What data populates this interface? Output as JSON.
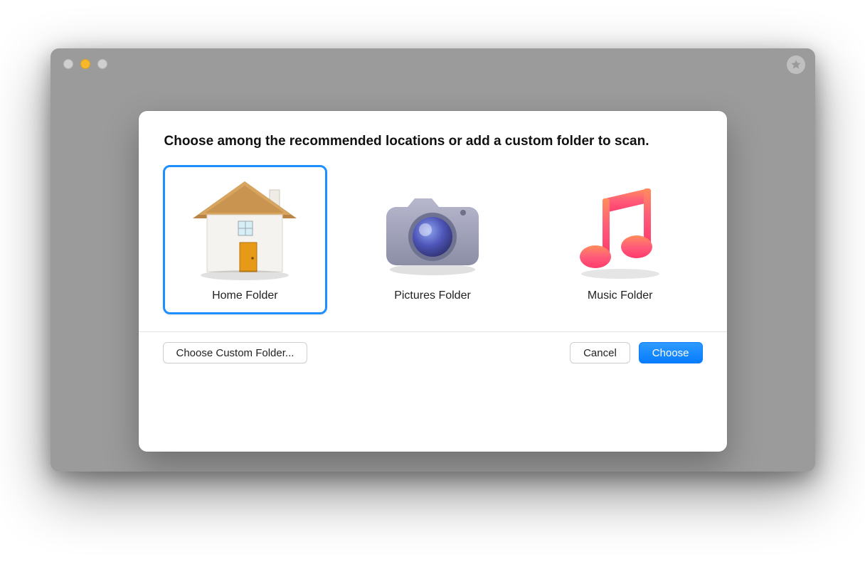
{
  "dialog": {
    "heading": "Choose among the recommended locations or add a custom folder to scan.",
    "options": [
      {
        "id": "home",
        "label": "Home Folder",
        "icon": "home-folder-icon",
        "selected": true
      },
      {
        "id": "pictures",
        "label": "Pictures Folder",
        "icon": "camera-icon",
        "selected": false
      },
      {
        "id": "music",
        "label": "Music Folder",
        "icon": "music-note-icon",
        "selected": false
      }
    ],
    "buttons": {
      "custom": "Choose Custom Folder...",
      "cancel": "Cancel",
      "confirm": "Choose"
    }
  },
  "window": {
    "traffic_lights": {
      "close": "inactive",
      "minimize": "active",
      "zoom": "inactive"
    },
    "corner_badge_icon": "star-icon"
  },
  "colors": {
    "selection": "#1E8FFF",
    "primary_button": "#067CFF",
    "window_bg": "#9b9b9b"
  }
}
